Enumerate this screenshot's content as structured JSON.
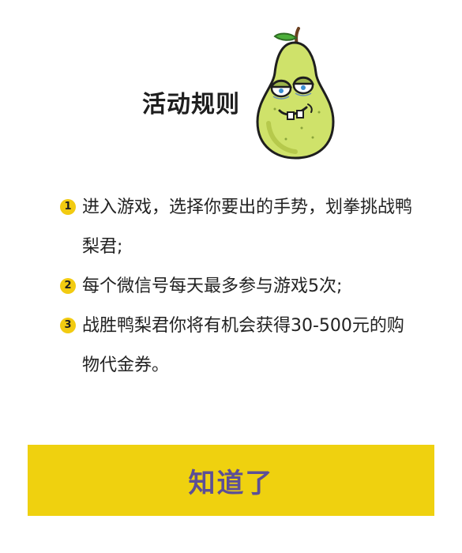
{
  "title": "活动规则",
  "rules": [
    {
      "num": "1",
      "text": "进入游戏，选择你要出的手势，划拳挑战鸭梨君;"
    },
    {
      "num": "2",
      "text": "每个微信号每天最多参与游戏5次;"
    },
    {
      "num": "3",
      "text": "战胜鸭梨君你将有机会获得30-500元的购物代金券。"
    }
  ],
  "confirm_label": "知道了",
  "colors": {
    "accent": "#efd10f",
    "button_text": "#5c4f96",
    "badge": "#f2cb11"
  },
  "icons": {
    "mascot": "pear-mascot-icon"
  }
}
